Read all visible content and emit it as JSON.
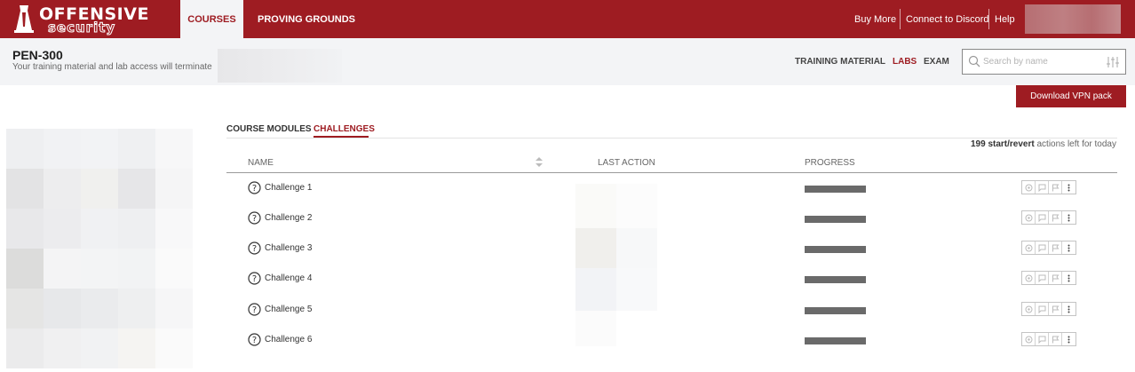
{
  "brand": {
    "name": "OFFENSIVE",
    "sub": "security"
  },
  "topnav": {
    "tabs": [
      {
        "label": "COURSES",
        "active": true
      },
      {
        "label": "PROVING GROUNDS",
        "active": false
      }
    ],
    "right": [
      "Buy More",
      "Connect to Discord",
      "Help"
    ]
  },
  "course": {
    "title": "PEN-300",
    "note": "Your training material and lab access will terminate"
  },
  "subnav": [
    {
      "label": "TRAINING MATERIAL",
      "active": false
    },
    {
      "label": "LABS",
      "active": true
    },
    {
      "label": "EXAM",
      "active": false
    }
  ],
  "search": {
    "placeholder": "Search by name",
    "value": ""
  },
  "vpn_button": "Download VPN pack",
  "content_tabs": [
    {
      "label": "COURSE MODULES",
      "active": false
    },
    {
      "label": "CHALLENGES",
      "active": true
    }
  ],
  "actions_left": {
    "count": "199 start/revert",
    "suffix": " actions left for today"
  },
  "table": {
    "columns": [
      "NAME",
      "LAST ACTION",
      "PROGRESS"
    ],
    "rows": [
      {
        "name": "Challenge 1"
      },
      {
        "name": "Challenge 2"
      },
      {
        "name": "Challenge 3"
      },
      {
        "name": "Challenge 4"
      },
      {
        "name": "Challenge 5"
      },
      {
        "name": "Challenge 6"
      }
    ]
  },
  "colors": {
    "brand": "#9e1c22",
    "subheader_bg": "#f3f4f6"
  },
  "icons": [
    "question-circle-icon",
    "search-icon",
    "filter-sliders-icon",
    "sort-icon",
    "revert-icon",
    "chat-icon",
    "flag-icon",
    "more-vertical-icon"
  ]
}
